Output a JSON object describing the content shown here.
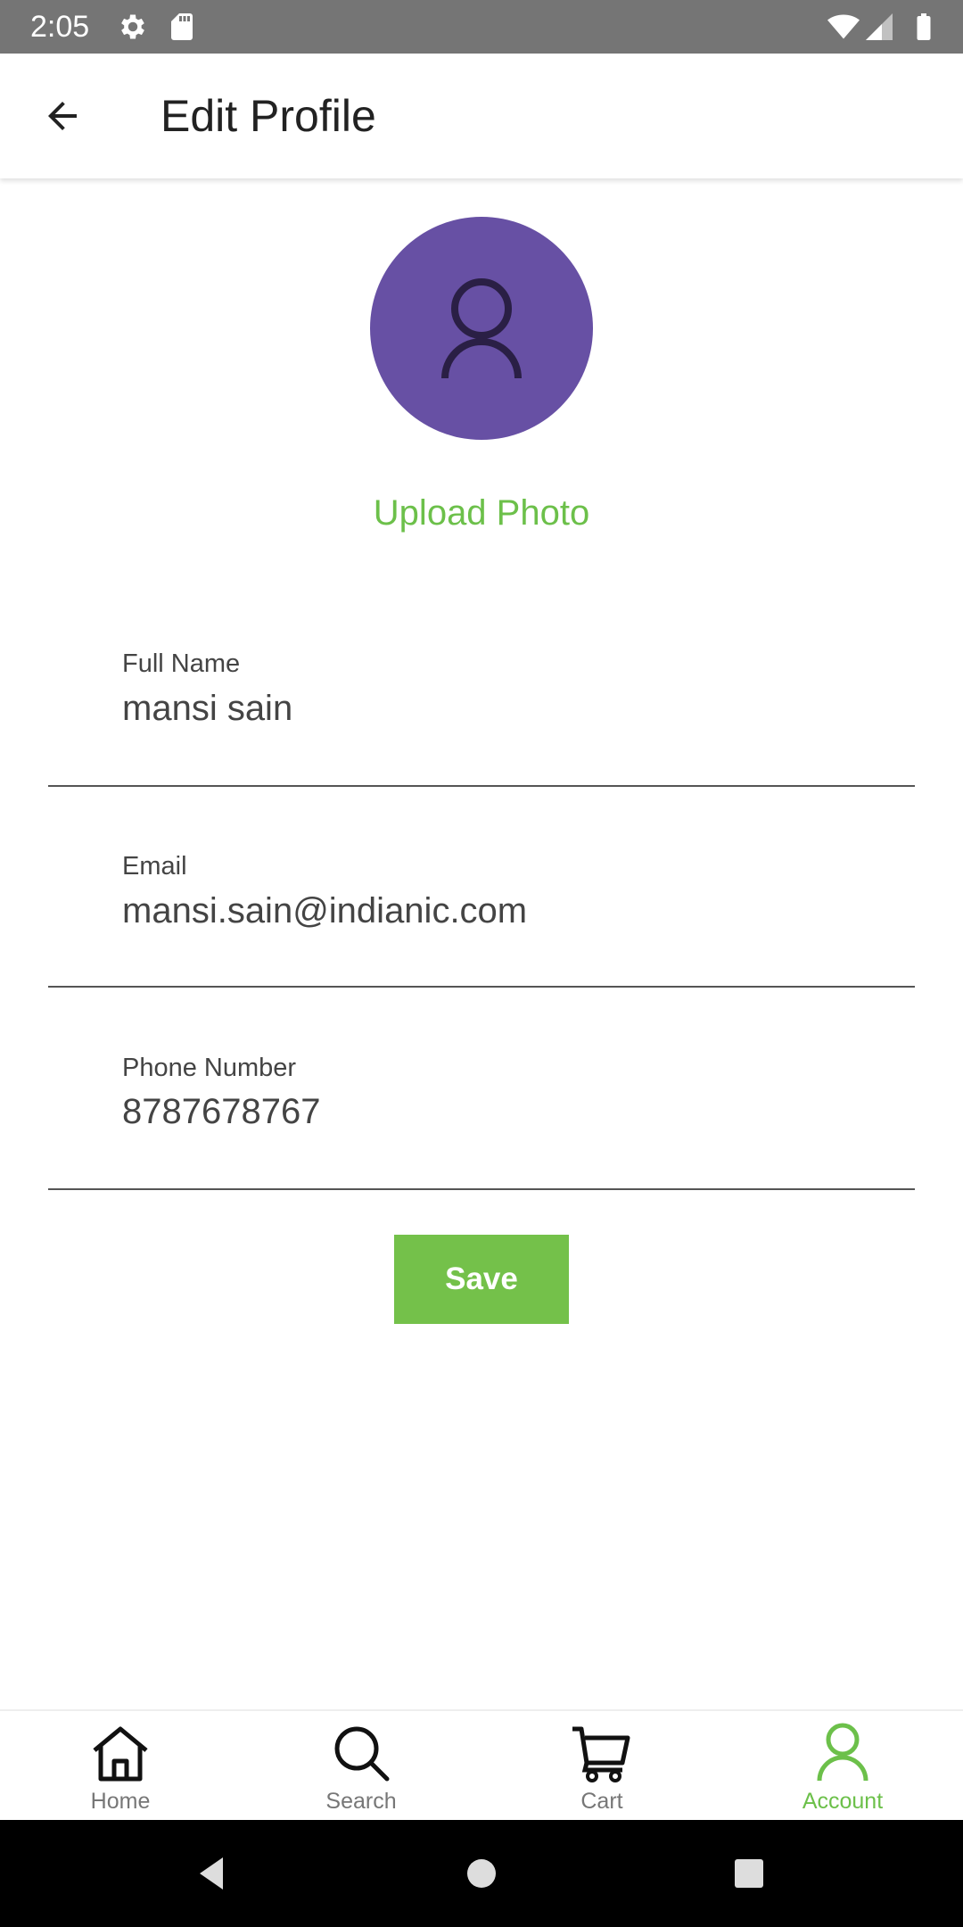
{
  "status_bar": {
    "time": "2:05",
    "icons": [
      "gear-icon",
      "sd-card-icon",
      "wifi-icon",
      "signal-icon",
      "battery-icon"
    ]
  },
  "app_bar": {
    "title": "Edit Profile",
    "back_icon": "arrow-left-icon"
  },
  "profile": {
    "avatar_icon": "person-icon",
    "avatar_color": "#6750a4",
    "upload_label": "Upload Photo"
  },
  "form": {
    "full_name": {
      "label": "Full Name",
      "value": "mansi sain"
    },
    "email": {
      "label": "Email",
      "value": "mansi.sain@indianic.com"
    },
    "phone": {
      "label": "Phone Number",
      "value": "8787678767"
    },
    "save_label": "Save"
  },
  "bottom_nav": {
    "items": [
      {
        "label": "Home",
        "icon": "home-icon",
        "active": false
      },
      {
        "label": "Search",
        "icon": "search-icon",
        "active": false
      },
      {
        "label": "Cart",
        "icon": "cart-icon",
        "active": false
      },
      {
        "label": "Account",
        "icon": "person-icon",
        "active": true
      }
    ]
  },
  "colors": {
    "accent": "#6cc04a",
    "save_button": "#74c14a",
    "avatar": "#6750a4",
    "status_bar": "#757575"
  }
}
